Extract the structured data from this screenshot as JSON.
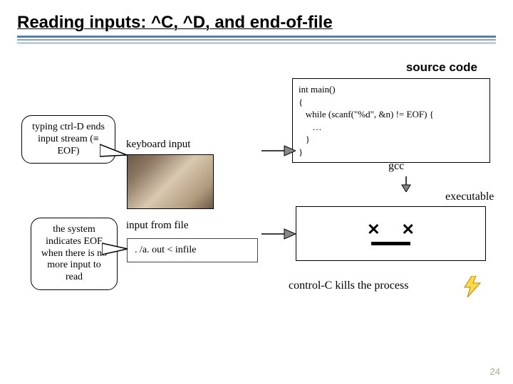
{
  "title": "Reading inputs: ^C, ^D, and end-of-file",
  "source_code_label": "source code",
  "code_lines": "int main()\n{\n   while (scanf(\"%d\", &n) != EOF) {\n      …\n   }\n}",
  "gcc_label": "gcc",
  "executable_label": "executable",
  "keyboard_label": "keyboard input",
  "file_label": "input from file",
  "cmd": ". /a. out < infile",
  "callout_ctrld": "typing ctrl-D ends input stream (≡ EOF)",
  "callout_eof": "the system indicates EOF when there is no more input to read",
  "ctrlc_label": "control-C kills the process",
  "page_number": "24"
}
